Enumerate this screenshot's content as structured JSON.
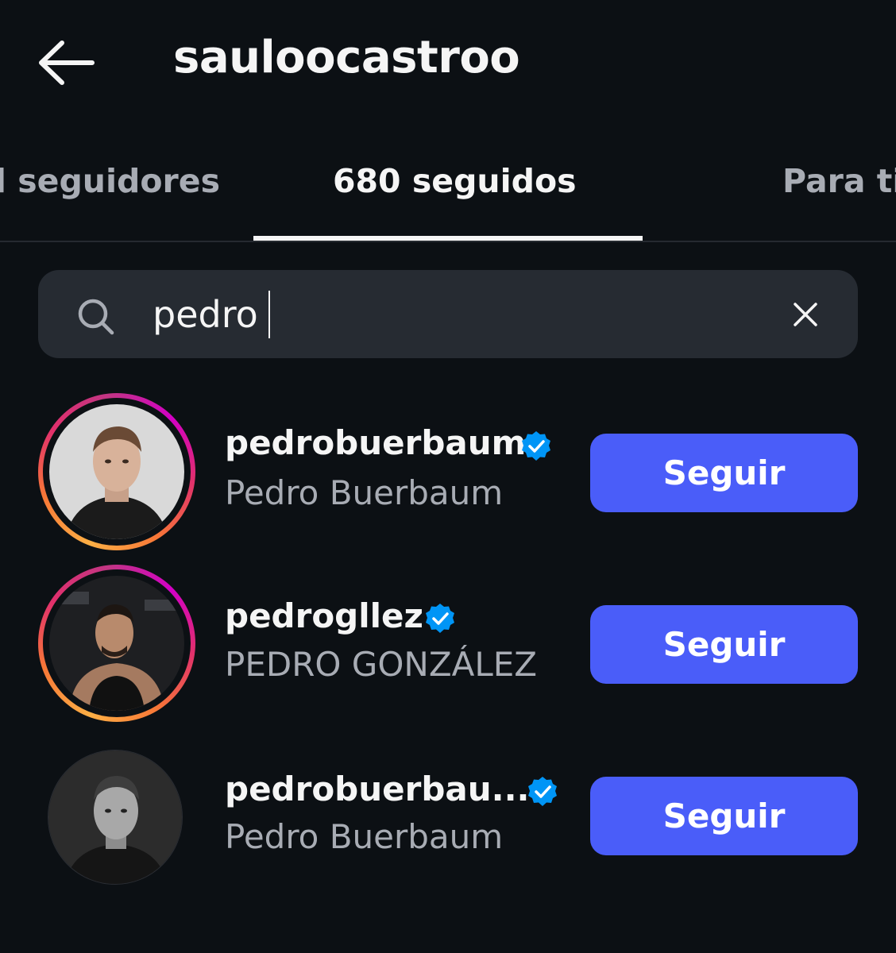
{
  "header": {
    "title": "sauloocastroo",
    "back_icon": "arrow-left-icon"
  },
  "tabs": [
    {
      "label": "il seguidores",
      "active": false
    },
    {
      "label": "680 seguidos",
      "active": true
    },
    {
      "label": "Para ti",
      "active": false
    }
  ],
  "search": {
    "value": "pedro",
    "placeholder": "",
    "search_icon": "search-icon",
    "clear_icon": "close-icon"
  },
  "results": [
    {
      "username": "pedrobuerbaum",
      "full_name": "Pedro Buerbaum",
      "verified": true,
      "story_ring": true,
      "button_label": "Seguir"
    },
    {
      "username": "pedrogllez",
      "full_name": "PEDRO GONZÁLEZ",
      "verified": true,
      "story_ring": true,
      "button_label": "Seguir"
    },
    {
      "username": "pedrobuerbau...",
      "full_name": "Pedro Buerbaum",
      "verified": true,
      "story_ring": false,
      "button_label": "Seguir"
    }
  ],
  "colors": {
    "background": "#0c1014",
    "search_bg": "#262b32",
    "button": "#4a5df9",
    "verified": "#0095f6",
    "secondary_text": "#a8acb4"
  }
}
